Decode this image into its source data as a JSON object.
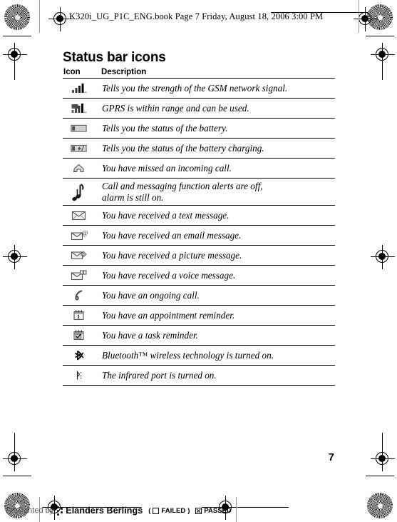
{
  "header": {
    "running_head": "K320i_UG_P1C_ENG.book  Page 7  Friday, August 18, 2006  3:00 PM"
  },
  "page": {
    "title": "Status bar icons",
    "page_number": "7"
  },
  "table": {
    "columns": [
      "Icon",
      "Description"
    ],
    "rows": [
      {
        "icon": "signal-strength-icon",
        "description": "Tells you the strength of the GSM network signal."
      },
      {
        "icon": "gprs-signal-icon",
        "description": "GPRS is within range and can be used."
      },
      {
        "icon": "battery-icon",
        "description": "Tells you the status of the battery."
      },
      {
        "icon": "battery-charging-icon",
        "description": "Tells you the status of the battery charging."
      },
      {
        "icon": "missed-call-icon",
        "description": "You have missed an incoming call."
      },
      {
        "icon": "silent-mode-note-icon",
        "description": "Call and messaging function alerts are off,",
        "description_line2": "alarm is still on."
      },
      {
        "icon": "text-message-icon",
        "description": "You have received a text message."
      },
      {
        "icon": "email-message-icon",
        "description": "You have received an email message."
      },
      {
        "icon": "picture-message-icon",
        "description": "You have received a picture message."
      },
      {
        "icon": "voice-message-icon",
        "description": "You have received a voice message."
      },
      {
        "icon": "ongoing-call-icon",
        "description": "You have an ongoing call."
      },
      {
        "icon": "appointment-reminder-icon",
        "description": "You have an appointment reminder."
      },
      {
        "icon": "task-reminder-icon",
        "description": "You have a task reminder."
      },
      {
        "icon": "bluetooth-icon",
        "description": "Bluetooth™ wireless technology is turned on."
      },
      {
        "icon": "infrared-icon",
        "description": "The infrared port is turned on."
      }
    ]
  },
  "preflight": {
    "prefix": "Preflighted by",
    "brand": "Elanders Berlings",
    "failed_open_paren": "(",
    "failed_label": "FAILED",
    "failed_close_paren": ")",
    "passed_label": "PASSED"
  }
}
